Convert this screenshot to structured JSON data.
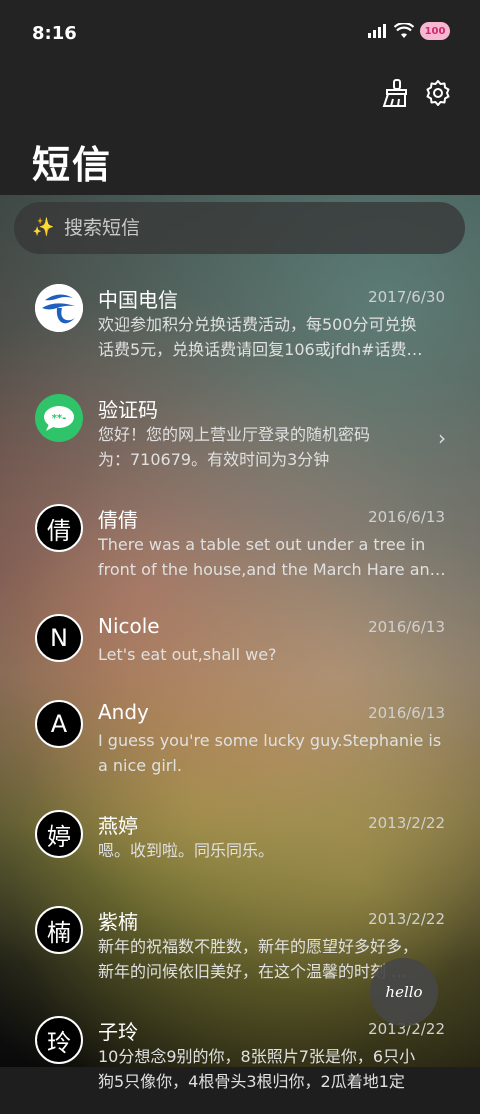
{
  "status": {
    "time": "8:16",
    "battery": "100"
  },
  "header": {
    "title": "短信"
  },
  "search": {
    "placeholder": "搜索短信"
  },
  "messages": [
    {
      "name": "中国电信",
      "date": "2017/6/30",
      "line1": "欢迎参加积分兑换话费活动，每500分可兑换",
      "line2": "话费5元，兑换话费请回复106或jfdh#话费…",
      "avatar": "telecom-logo"
    },
    {
      "name": "验证码",
      "date": "",
      "line1": "您好！您的网上营业厅登录的随机密码",
      "line2": "为：710679。有效时间为3分钟",
      "avatar": "message-icon"
    },
    {
      "name": "倩倩",
      "date": "2016/6/13",
      "line1": "There was a table set out under a tree in",
      "line2": "front of the house,and the March Hare an…",
      "avatar_text": "倩"
    },
    {
      "name": "Nicole",
      "date": "2016/6/13",
      "line1": "Let's eat out,shall we?",
      "line2": "",
      "avatar_text": "N"
    },
    {
      "name": "Andy",
      "date": "2016/6/13",
      "line1": "I guess you're some lucky guy.Stephanie is",
      "line2": "a nice girl.",
      "avatar_text": "A"
    },
    {
      "name": "燕婷",
      "date": "2013/2/22",
      "line1": "嗯。收到啦。同乐同乐。",
      "line2": "",
      "avatar_text": "婷"
    },
    {
      "name": "紫楠",
      "date": "2013/2/22",
      "line1": "新年的祝福数不胜数，新年的愿望好多好多，",
      "line2": "新年的问候依旧美好，在这个温馨的时刻 …",
      "avatar_text": "楠"
    },
    {
      "name": "子玲",
      "date": "2013/2/22",
      "line1": "10分想念9别的你，8张照片7张是你，6只小",
      "line2": "狗5只像你，4根骨头3根归你，2瓜着地1定",
      "avatar_text": "玲"
    }
  ],
  "fab": {
    "label": "hello"
  },
  "colors": {
    "header_bg": "#232323",
    "telecom_blue": "#1f5fbf",
    "message_green": "#2fc36a"
  }
}
